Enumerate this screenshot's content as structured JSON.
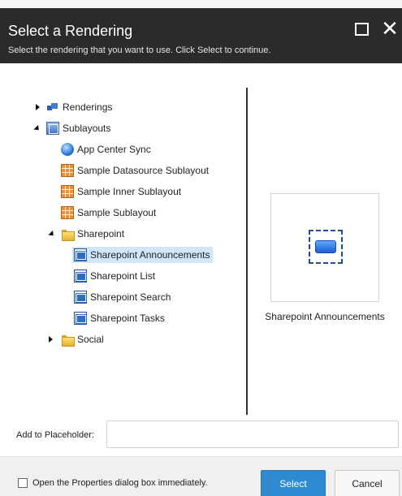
{
  "dialog": {
    "title": "Select a Rendering",
    "subtitle": "Select the rendering that you want to use. Click Select to continue.",
    "maximize_icon": "maximize-icon",
    "close_icon": "close-icon",
    "close_glyph": "✕"
  },
  "tree": {
    "items": [
      {
        "label": "Renderings",
        "icon": "renderings-icon",
        "expander": "collapsed"
      },
      {
        "label": "Sublayouts",
        "icon": "sublayouts-icon",
        "expander": "expanded"
      },
      {
        "label": "App Center Sync",
        "icon": "app-center-icon"
      },
      {
        "label": "Sample Datasource Sublayout",
        "icon": "sublayout-grid-icon"
      },
      {
        "label": "Sample Inner Sublayout",
        "icon": "sublayout-grid-icon"
      },
      {
        "label": "Sample Sublayout",
        "icon": "sublayout-grid-icon"
      },
      {
        "label": "Sharepoint",
        "icon": "folder-icon",
        "expander": "expanded"
      },
      {
        "label": "Sharepoint Announcements",
        "icon": "sharepoint-rendering-icon",
        "selected": true
      },
      {
        "label": "Sharepoint List",
        "icon": "sharepoint-rendering-icon"
      },
      {
        "label": "Sharepoint Search",
        "icon": "sharepoint-rendering-icon"
      },
      {
        "label": "Sharepoint Tasks",
        "icon": "sharepoint-rendering-icon"
      },
      {
        "label": "Social",
        "icon": "folder-icon",
        "expander": "collapsed"
      }
    ]
  },
  "preview": {
    "label": "Sharepoint Announcements",
    "icon": "sharepoint-rendering-large-icon"
  },
  "placeholder": {
    "label": "Add to Placeholder:",
    "value": "",
    "placeholder": ""
  },
  "footer": {
    "checkbox_label": "Open the Properties dialog box immediately.",
    "checkbox_checked": false,
    "select_label": "Select",
    "cancel_label": "Cancel"
  },
  "colors": {
    "header_bg": "#2b2b2b",
    "selected_bg": "#cfe7f7",
    "primary_button": "#2f8bd1"
  }
}
